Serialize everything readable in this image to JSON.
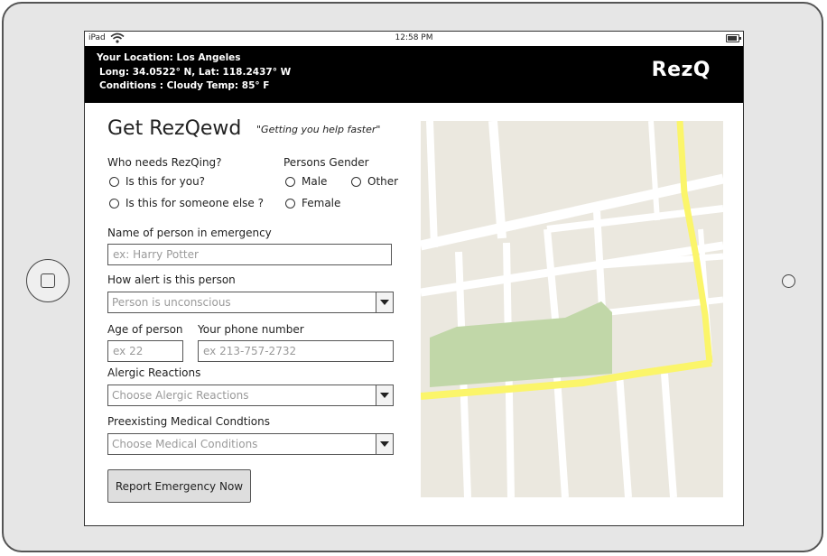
{
  "status_bar": {
    "carrier": "iPad",
    "time": "12:58 PM"
  },
  "header": {
    "location_line": "Your Location: Los Angeles",
    "coords_line": "Long:  34.0522° N,  Lat: 118.2437° W",
    "conditions_line": "Conditions : Cloudy    Temp: 85° F",
    "brand": "RezQ"
  },
  "page": {
    "title": "Get RezQewd",
    "tagline": "\"Getting you help faster\""
  },
  "form": {
    "who_label": "Who needs RezQing?",
    "who_options": [
      "Is this for you?",
      "Is this for someone else ?"
    ],
    "gender_label": "Persons Gender",
    "gender_options": [
      "Male",
      "Other",
      "Female"
    ],
    "name_label": "Name of person in emergency",
    "name_placeholder": "ex: Harry Potter",
    "alert_label": "How alert is this person",
    "alert_value": "Person is unconscious",
    "age_label": "Age of person",
    "age_placeholder": "ex 22",
    "phone_label": "Your phone number",
    "phone_placeholder": "ex 213-757-2732",
    "allergy_label": "Alergic Reactions",
    "allergy_value": "Choose Alergic Reactions",
    "conditions_label": "Preexisting Medical Condtions",
    "conditions_value": "Choose Medical Conditions",
    "submit_label": "Report Emergency Now"
  },
  "map": {
    "land_color": "#ebe8df",
    "road_color": "#ffffff",
    "highway_color": "#fbf56a",
    "park_color": "#c1d7a8",
    "icons": [
      "map"
    ]
  },
  "colors": {
    "header_bg": "#000000",
    "header_text": "#ffffff",
    "button_bg": "#dedede"
  }
}
